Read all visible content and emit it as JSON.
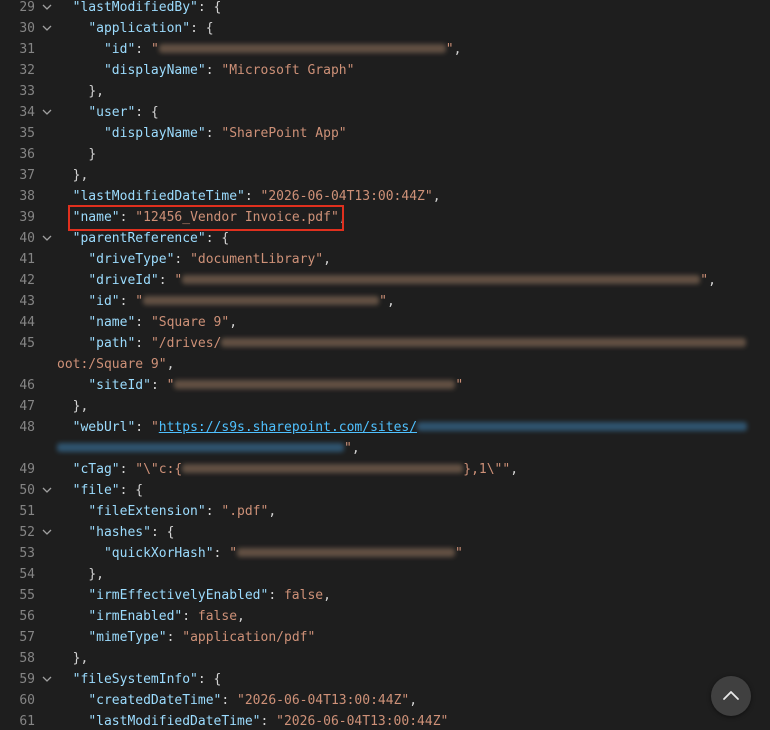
{
  "editor": {
    "lines": [
      {
        "n": "29",
        "fold": true,
        "tokens": [
          {
            "t": "ind",
            "v": "  "
          },
          {
            "t": "key",
            "v": "\"lastModifiedBy\""
          },
          {
            "t": "p",
            "v": ": {"
          }
        ]
      },
      {
        "n": "30",
        "fold": true,
        "tokens": [
          {
            "t": "ind",
            "v": "    "
          },
          {
            "t": "key",
            "v": "\"application\""
          },
          {
            "t": "p",
            "v": ": {"
          }
        ]
      },
      {
        "n": "31",
        "fold": false,
        "tokens": [
          {
            "t": "ind",
            "v": "      "
          },
          {
            "t": "key",
            "v": "\"id\""
          },
          {
            "t": "p",
            "v": ": "
          },
          {
            "t": "str",
            "v": "\""
          },
          {
            "t": "red",
            "w": 287,
            "c": "str"
          },
          {
            "t": "str",
            "v": "\""
          },
          {
            "t": "p",
            "v": ","
          }
        ]
      },
      {
        "n": "32",
        "fold": false,
        "tokens": [
          {
            "t": "ind",
            "v": "      "
          },
          {
            "t": "key",
            "v": "\"displayName\""
          },
          {
            "t": "p",
            "v": ": "
          },
          {
            "t": "str",
            "v": "\"Microsoft Graph\""
          }
        ]
      },
      {
        "n": "33",
        "fold": false,
        "tokens": [
          {
            "t": "ind",
            "v": "    "
          },
          {
            "t": "p",
            "v": "},"
          }
        ]
      },
      {
        "n": "34",
        "fold": true,
        "tokens": [
          {
            "t": "ind",
            "v": "    "
          },
          {
            "t": "key",
            "v": "\"user\""
          },
          {
            "t": "p",
            "v": ": {"
          }
        ]
      },
      {
        "n": "35",
        "fold": false,
        "tokens": [
          {
            "t": "ind",
            "v": "      "
          },
          {
            "t": "key",
            "v": "\"displayName\""
          },
          {
            "t": "p",
            "v": ": "
          },
          {
            "t": "str",
            "v": "\"SharePoint App\""
          }
        ]
      },
      {
        "n": "36",
        "fold": false,
        "tokens": [
          {
            "t": "ind",
            "v": "    "
          },
          {
            "t": "p",
            "v": "}"
          }
        ]
      },
      {
        "n": "37",
        "fold": false,
        "tokens": [
          {
            "t": "ind",
            "v": "  "
          },
          {
            "t": "p",
            "v": "},"
          }
        ]
      },
      {
        "n": "38",
        "fold": false,
        "tokens": [
          {
            "t": "ind",
            "v": "  "
          },
          {
            "t": "key",
            "v": "\"lastModifiedDateTime\""
          },
          {
            "t": "p",
            "v": ": "
          },
          {
            "t": "str",
            "v": "\"2026-06-04T13:00:44Z\""
          },
          {
            "t": "p",
            "v": ","
          }
        ]
      },
      {
        "n": "39",
        "fold": false,
        "tokens": [
          {
            "t": "ind",
            "v": "  "
          },
          {
            "t": "key",
            "v": "\"name\""
          },
          {
            "t": "p",
            "v": ": "
          },
          {
            "t": "str",
            "v": "\"12456_Vendor Invoice.pdf\""
          },
          {
            "t": "p",
            "v": ","
          }
        ]
      },
      {
        "n": "40",
        "fold": true,
        "tokens": [
          {
            "t": "ind",
            "v": "  "
          },
          {
            "t": "key",
            "v": "\"parentReference\""
          },
          {
            "t": "p",
            "v": ": {"
          }
        ]
      },
      {
        "n": "41",
        "fold": false,
        "tokens": [
          {
            "t": "ind",
            "v": "    "
          },
          {
            "t": "key",
            "v": "\"driveType\""
          },
          {
            "t": "p",
            "v": ": "
          },
          {
            "t": "str",
            "v": "\"documentLibrary\""
          },
          {
            "t": "p",
            "v": ","
          }
        ]
      },
      {
        "n": "42",
        "fold": false,
        "tokens": [
          {
            "t": "ind",
            "v": "    "
          },
          {
            "t": "key",
            "v": "\"driveId\""
          },
          {
            "t": "p",
            "v": ": "
          },
          {
            "t": "str",
            "v": "\""
          },
          {
            "t": "red",
            "w": 518,
            "c": "str"
          },
          {
            "t": "str",
            "v": "\""
          },
          {
            "t": "p",
            "v": ","
          }
        ]
      },
      {
        "n": "43",
        "fold": false,
        "tokens": [
          {
            "t": "ind",
            "v": "    "
          },
          {
            "t": "key",
            "v": "\"id\""
          },
          {
            "t": "p",
            "v": ": "
          },
          {
            "t": "str",
            "v": "\""
          },
          {
            "t": "red",
            "w": 236,
            "c": "str"
          },
          {
            "t": "str",
            "v": "\""
          },
          {
            "t": "p",
            "v": ","
          }
        ]
      },
      {
        "n": "44",
        "fold": false,
        "tokens": [
          {
            "t": "ind",
            "v": "    "
          },
          {
            "t": "key",
            "v": "\"name\""
          },
          {
            "t": "p",
            "v": ": "
          },
          {
            "t": "str",
            "v": "\"Square 9\""
          },
          {
            "t": "p",
            "v": ","
          }
        ]
      },
      {
        "n": "45",
        "fold": false,
        "tokens": [
          {
            "t": "ind",
            "v": "    "
          },
          {
            "t": "key",
            "v": "\"path\""
          },
          {
            "t": "p",
            "v": ": "
          },
          {
            "t": "str",
            "v": "\"/drives/"
          },
          {
            "t": "red",
            "w": 525,
            "c": "str"
          }
        ]
      },
      {
        "n": "",
        "fold": false,
        "tokens": [
          {
            "t": "str",
            "v": "oot:/Square 9\""
          },
          {
            "t": "p",
            "v": ","
          }
        ]
      },
      {
        "n": "46",
        "fold": false,
        "tokens": [
          {
            "t": "ind",
            "v": "    "
          },
          {
            "t": "key",
            "v": "\"siteId\""
          },
          {
            "t": "p",
            "v": ": "
          },
          {
            "t": "str",
            "v": "\""
          },
          {
            "t": "red",
            "w": 281,
            "c": "str"
          },
          {
            "t": "str",
            "v": "\""
          }
        ]
      },
      {
        "n": "47",
        "fold": false,
        "tokens": [
          {
            "t": "ind",
            "v": "  "
          },
          {
            "t": "p",
            "v": "},"
          }
        ]
      },
      {
        "n": "48",
        "fold": false,
        "tokens": [
          {
            "t": "ind",
            "v": "  "
          },
          {
            "t": "key",
            "v": "\"webUrl\""
          },
          {
            "t": "p",
            "v": ": "
          },
          {
            "t": "str",
            "v": "\""
          },
          {
            "t": "link",
            "v": "https://s9s.sharepoint.com/sites/"
          },
          {
            "t": "red",
            "w": 330,
            "c": "link"
          }
        ]
      },
      {
        "n": "",
        "fold": false,
        "tokens": [
          {
            "t": "red",
            "w": 287,
            "c": "link"
          },
          {
            "t": "str",
            "v": "\""
          },
          {
            "t": "p",
            "v": ","
          }
        ]
      },
      {
        "n": "49",
        "fold": false,
        "tokens": [
          {
            "t": "ind",
            "v": "  "
          },
          {
            "t": "key",
            "v": "\"cTag\""
          },
          {
            "t": "p",
            "v": ": "
          },
          {
            "t": "str",
            "v": "\"\\\"c:{"
          },
          {
            "t": "red",
            "w": 281,
            "c": "str"
          },
          {
            "t": "str",
            "v": "},1\\\"\""
          },
          {
            "t": "p",
            "v": ","
          }
        ]
      },
      {
        "n": "50",
        "fold": true,
        "tokens": [
          {
            "t": "ind",
            "v": "  "
          },
          {
            "t": "key",
            "v": "\"file\""
          },
          {
            "t": "p",
            "v": ": {"
          }
        ]
      },
      {
        "n": "51",
        "fold": false,
        "tokens": [
          {
            "t": "ind",
            "v": "    "
          },
          {
            "t": "key",
            "v": "\"fileExtension\""
          },
          {
            "t": "p",
            "v": ": "
          },
          {
            "t": "str",
            "v": "\".pdf\""
          },
          {
            "t": "p",
            "v": ","
          }
        ]
      },
      {
        "n": "52",
        "fold": true,
        "tokens": [
          {
            "t": "ind",
            "v": "    "
          },
          {
            "t": "key",
            "v": "\"hashes\""
          },
          {
            "t": "p",
            "v": ": {"
          }
        ]
      },
      {
        "n": "53",
        "fold": false,
        "tokens": [
          {
            "t": "ind",
            "v": "      "
          },
          {
            "t": "key",
            "v": "\"quickXorHash\""
          },
          {
            "t": "p",
            "v": ": "
          },
          {
            "t": "str",
            "v": "\""
          },
          {
            "t": "red",
            "w": 218,
            "c": "str"
          },
          {
            "t": "str",
            "v": "\""
          }
        ]
      },
      {
        "n": "54",
        "fold": false,
        "tokens": [
          {
            "t": "ind",
            "v": "    "
          },
          {
            "t": "p",
            "v": "},"
          }
        ]
      },
      {
        "n": "55",
        "fold": false,
        "tokens": [
          {
            "t": "ind",
            "v": "    "
          },
          {
            "t": "key",
            "v": "\"irmEffectivelyEnabled\""
          },
          {
            "t": "p",
            "v": ": "
          },
          {
            "t": "kw",
            "v": "false"
          },
          {
            "t": "p",
            "v": ","
          }
        ]
      },
      {
        "n": "56",
        "fold": false,
        "tokens": [
          {
            "t": "ind",
            "v": "    "
          },
          {
            "t": "key",
            "v": "\"irmEnabled\""
          },
          {
            "t": "p",
            "v": ": "
          },
          {
            "t": "kw",
            "v": "false"
          },
          {
            "t": "p",
            "v": ","
          }
        ]
      },
      {
        "n": "57",
        "fold": false,
        "tokens": [
          {
            "t": "ind",
            "v": "    "
          },
          {
            "t": "key",
            "v": "\"mimeType\""
          },
          {
            "t": "p",
            "v": ": "
          },
          {
            "t": "str",
            "v": "\"application/pdf\""
          }
        ]
      },
      {
        "n": "58",
        "fold": false,
        "tokens": [
          {
            "t": "ind",
            "v": "  "
          },
          {
            "t": "p",
            "v": "},"
          }
        ]
      },
      {
        "n": "59",
        "fold": true,
        "tokens": [
          {
            "t": "ind",
            "v": "  "
          },
          {
            "t": "key",
            "v": "\"fileSystemInfo\""
          },
          {
            "t": "p",
            "v": ": {"
          }
        ]
      },
      {
        "n": "60",
        "fold": false,
        "tokens": [
          {
            "t": "ind",
            "v": "    "
          },
          {
            "t": "key",
            "v": "\"createdDateTime\""
          },
          {
            "t": "p",
            "v": ": "
          },
          {
            "t": "str",
            "v": "\"2026-06-04T13:00:44Z\""
          },
          {
            "t": "p",
            "v": ","
          }
        ]
      },
      {
        "n": "61",
        "fold": false,
        "tokens": [
          {
            "t": "ind",
            "v": "    "
          },
          {
            "t": "key",
            "v": "\"lastModifiedDateTime\""
          },
          {
            "t": "p",
            "v": ": "
          },
          {
            "t": "str",
            "v": "\"2026-06-04T13:00:44Z\""
          }
        ]
      }
    ]
  },
  "colors": {
    "background": "#1e1e1e",
    "key": "#9cdcfe",
    "string": "#ce9178",
    "punctuation": "#d4d4d4",
    "line_number": "#858585",
    "link": "#4fc1ff",
    "highlight_border": "#e0301e"
  },
  "icons": {
    "fold": "chevron-down-icon",
    "scroll_top": "chevron-up-icon"
  }
}
